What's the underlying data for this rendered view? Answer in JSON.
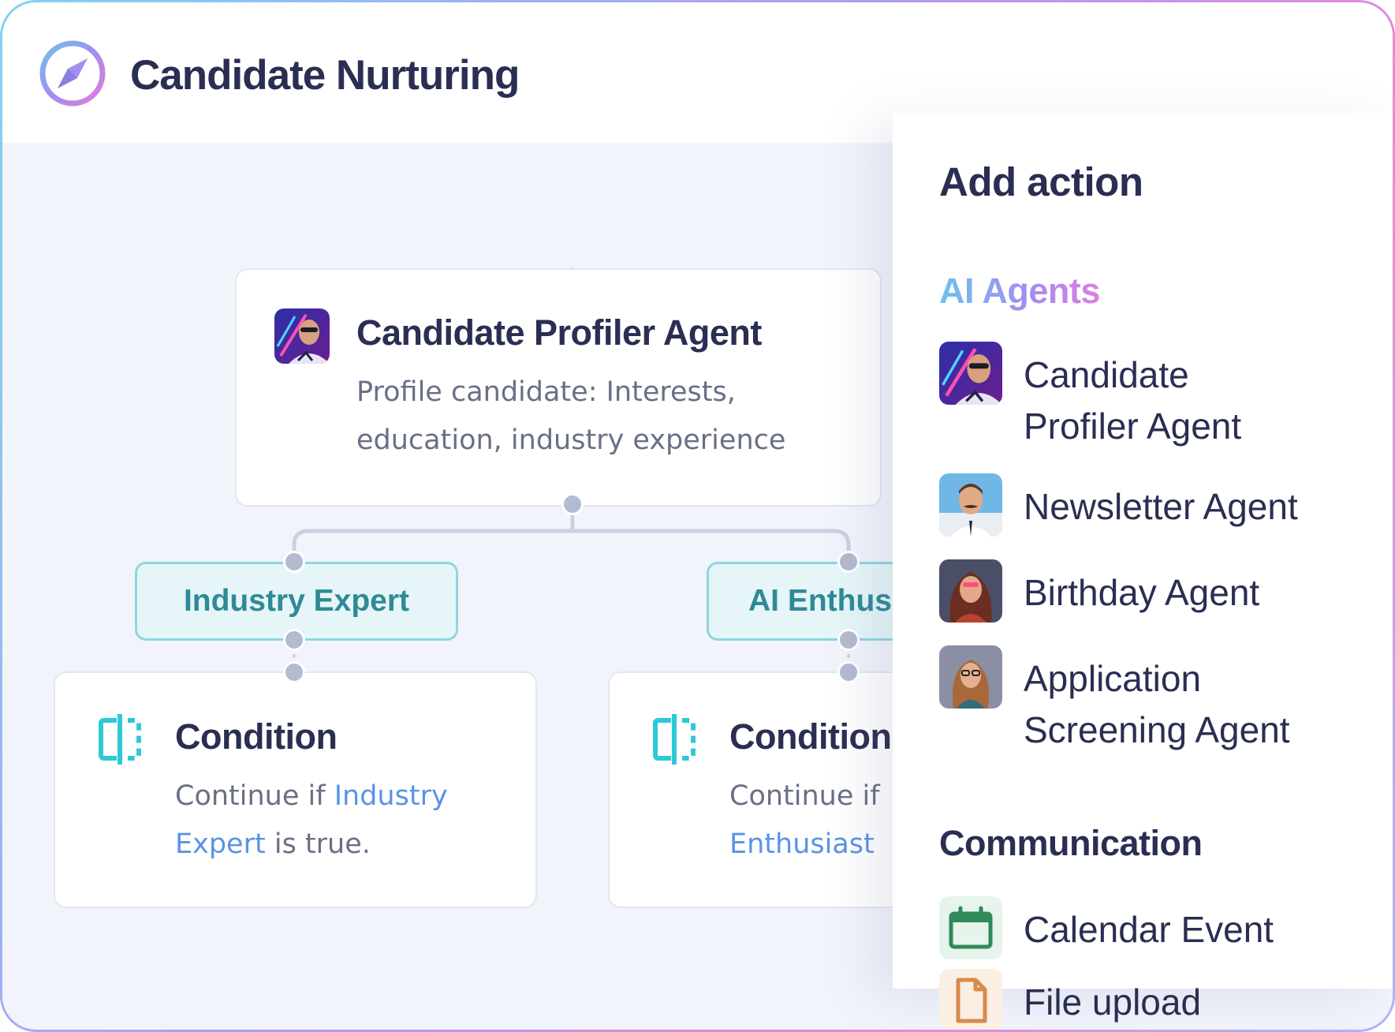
{
  "app": {
    "title": "Candidate Nurturing",
    "icon": "compass-icon",
    "accent_colors": [
      "#6fc2ef",
      "#a48cf0",
      "#dc7fe0"
    ]
  },
  "flow": {
    "agent_card": {
      "title": "Candidate Profiler Agent",
      "description_line1": "Profile candidate: Interests,",
      "description_line2": "education, industry experience"
    },
    "branches": [
      {
        "pill": "Industry Expert",
        "condition_title": "Condition",
        "condition_prefix": "Continue if",
        "condition_highlight_1": "Industry",
        "condition_highlight_2": "Expert",
        "condition_suffix": "is true."
      },
      {
        "pill": "AI Enthus",
        "condition_title": "Condition",
        "condition_prefix": "Continue if",
        "condition_highlight_2": "Enthusiast"
      }
    ]
  },
  "panel": {
    "title": "Add action",
    "sections": {
      "ai_agents": {
        "label": "AI Agents",
        "items": [
          {
            "label": "Candidate\nProfiler Agent",
            "icon": "profiler-avatar"
          },
          {
            "label": "Newsletter Agent",
            "icon": "newsletter-avatar"
          },
          {
            "label": "Birthday Agent",
            "icon": "birthday-avatar"
          },
          {
            "label": "Application\nScreening Agent",
            "icon": "screening-avatar"
          }
        ]
      },
      "communication": {
        "label": "Communication",
        "items": [
          {
            "label": "Calendar Event",
            "icon": "calendar-icon",
            "color": "#2f8a5a"
          },
          {
            "label": "File upload",
            "icon": "file-icon",
            "color": "#d98a4c"
          }
        ]
      }
    }
  }
}
